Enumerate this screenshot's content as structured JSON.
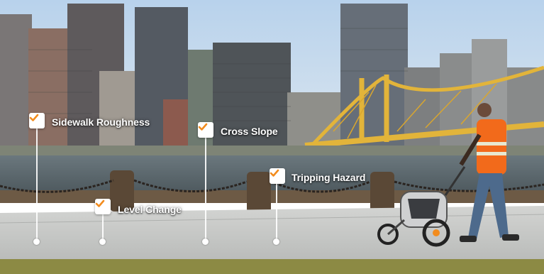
{
  "photo": {
    "scene": "riverfront-sidewalk-with-city-skyline-and-yellow-bridge",
    "colors": {
      "sky": "#c9dcef",
      "bridge": "#e2b43a",
      "vest": "#f26a1b",
      "sidewalk": "#c9cbc9",
      "check": "#f28c1e"
    }
  },
  "callouts": [
    {
      "id": "sidewalk-roughness",
      "label": "Sidewalk Roughness",
      "icon": "checkmark-icon"
    },
    {
      "id": "cross-slope",
      "label": "Cross Slope",
      "icon": "checkmark-icon"
    },
    {
      "id": "tripping-hazard",
      "label": "Tripping Hazard",
      "icon": "checkmark-icon"
    },
    {
      "id": "level-change",
      "label": "Level Change",
      "icon": "checkmark-icon"
    }
  ]
}
